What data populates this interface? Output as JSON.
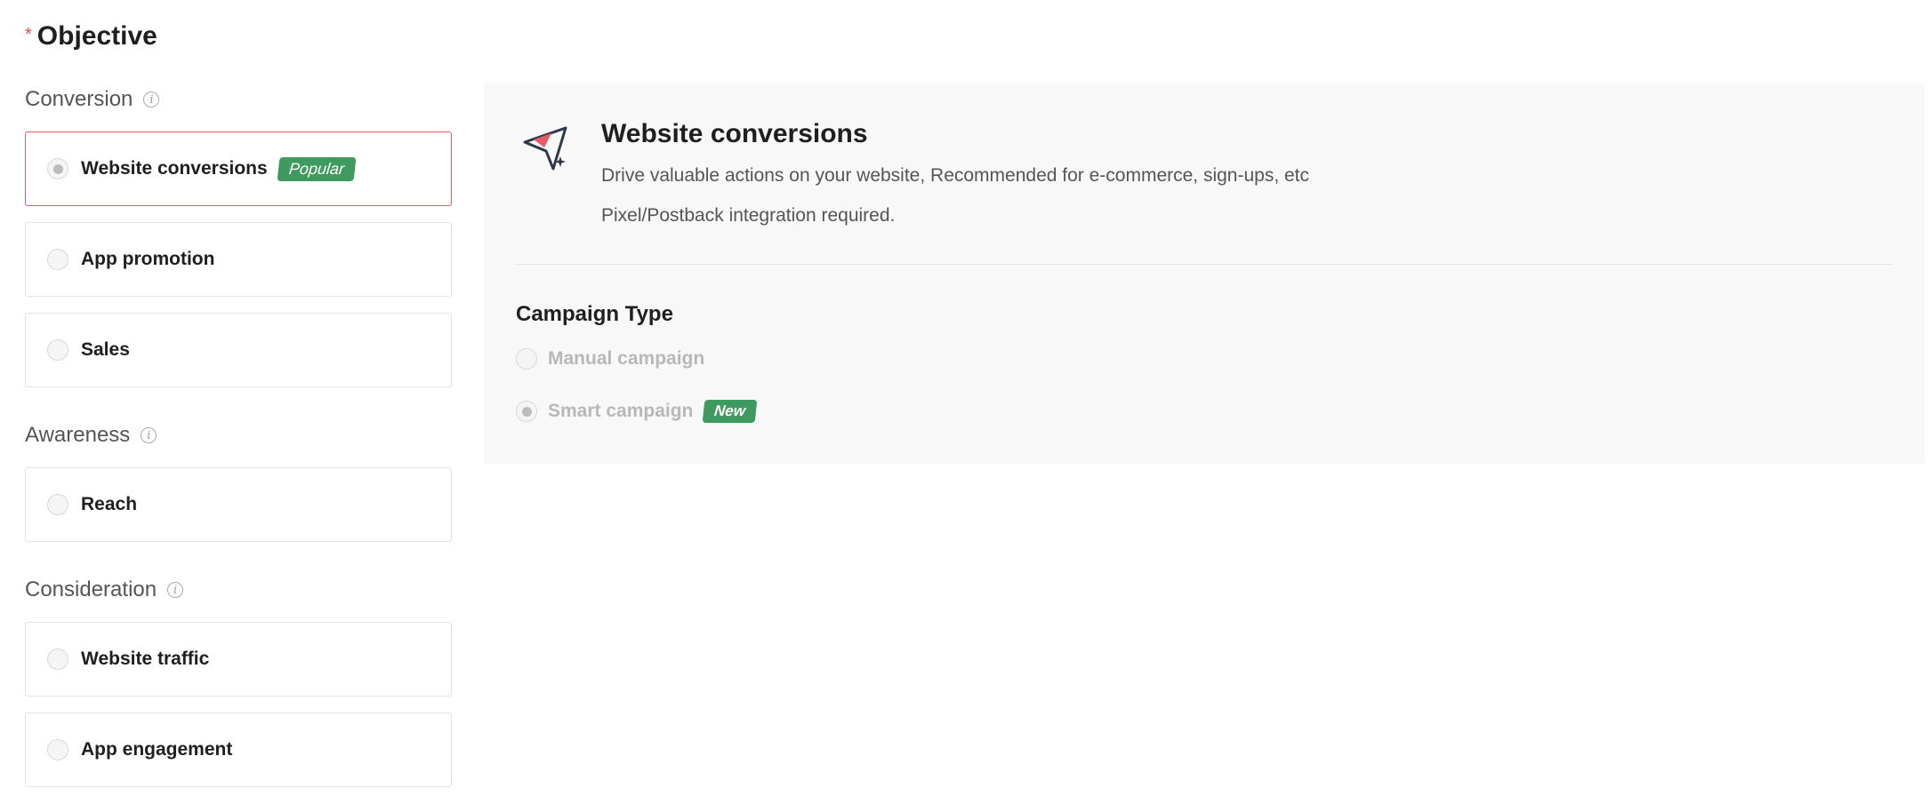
{
  "header": {
    "required_mark": "*",
    "title": "Objective"
  },
  "groups": {
    "conversion": {
      "label": "Conversion",
      "options": [
        {
          "label": "Website conversions",
          "badge": "Popular",
          "selected": true
        },
        {
          "label": "App promotion",
          "selected": false
        },
        {
          "label": "Sales",
          "selected": false
        }
      ]
    },
    "awareness": {
      "label": "Awareness",
      "options": [
        {
          "label": "Reach",
          "selected": false
        }
      ]
    },
    "consideration": {
      "label": "Consideration",
      "options": [
        {
          "label": "Website traffic",
          "selected": false
        },
        {
          "label": "App engagement",
          "selected": false
        }
      ]
    }
  },
  "detail": {
    "icon": "paper-plane-icon",
    "title": "Website conversions",
    "description": "Drive valuable actions on your website, Recommended for e-commerce, sign-ups, etc",
    "requirement": "Pixel/Postback integration required.",
    "campaign_type": {
      "label": "Campaign Type",
      "options": [
        {
          "label": "Manual campaign",
          "selected": false
        },
        {
          "label": "Smart campaign",
          "badge": "New",
          "selected": true
        }
      ]
    }
  },
  "colors": {
    "accent_red": "#f05a66",
    "badge_green": "#3f9a5f",
    "panel_bg": "#f8f8f8"
  }
}
